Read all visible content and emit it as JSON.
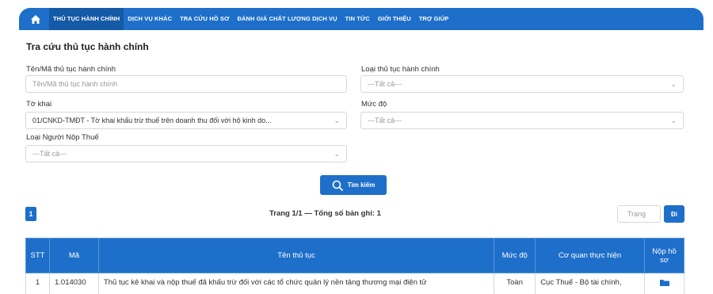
{
  "nav": {
    "items": [
      {
        "label": "THỦ TỤC HÀNH CHÍNH",
        "active": true
      },
      {
        "label": "DỊCH VỤ KHÁC",
        "active": false
      },
      {
        "label": "TRA CỨU HỒ SƠ",
        "active": false
      },
      {
        "label": "ĐÁNH GIÁ CHẤT LƯỢNG DỊCH VỤ",
        "active": false
      },
      {
        "label": "TIN TỨC",
        "active": false
      },
      {
        "label": "GIỚI THIỆU",
        "active": false
      },
      {
        "label": "TRỢ GIÚP",
        "active": false
      }
    ],
    "home_icon": "home-icon"
  },
  "search_form": {
    "title": "Tra cứu thủ tục hành chính",
    "name_label": "Tên/Mã thủ tục hành chính",
    "name_placeholder": "Tên/Mã thủ tục hành chính",
    "type_label": "Loại thủ tục hành chính",
    "type_value": "---Tất cả---",
    "form_label": "Tờ khai",
    "form_value": "01/CNKD-TMĐT - Tờ khai khấu trừ thuế trên doanh thu đối với hộ kinh do...",
    "level_label": "Mức độ",
    "level_value": "---Tất cả---",
    "taxpayer_label": "Loại Người Nộp Thuế",
    "taxpayer_value": "---Tất cả---",
    "search_button": "Tìm kiếm"
  },
  "pagination": {
    "current_page": "1",
    "summary": "Trang 1/1 — Tổng số bản ghi: 1",
    "page_input_placeholder": "Trang",
    "go_button": "Đi"
  },
  "table": {
    "headers": [
      "STT",
      "Mã",
      "Tên thủ tục",
      "Mức độ",
      "Cơ quan thực hiện",
      "Nộp hồ sơ"
    ],
    "rows": [
      {
        "stt": "1",
        "code": "1.014030",
        "name": "Thủ tục kê khai và nộp thuế đã khấu trừ đối với các tổ chức quản lý nền tảng thương mại điện tử",
        "level": "Toàn",
        "agency": "Cục Thuế - Bộ tài chính,",
        "submit_icon": "folder-icon"
      }
    ]
  },
  "colors": {
    "primary": "#1e6fc9",
    "active_nav": "#155aa6",
    "link": "#1e5fb3"
  }
}
